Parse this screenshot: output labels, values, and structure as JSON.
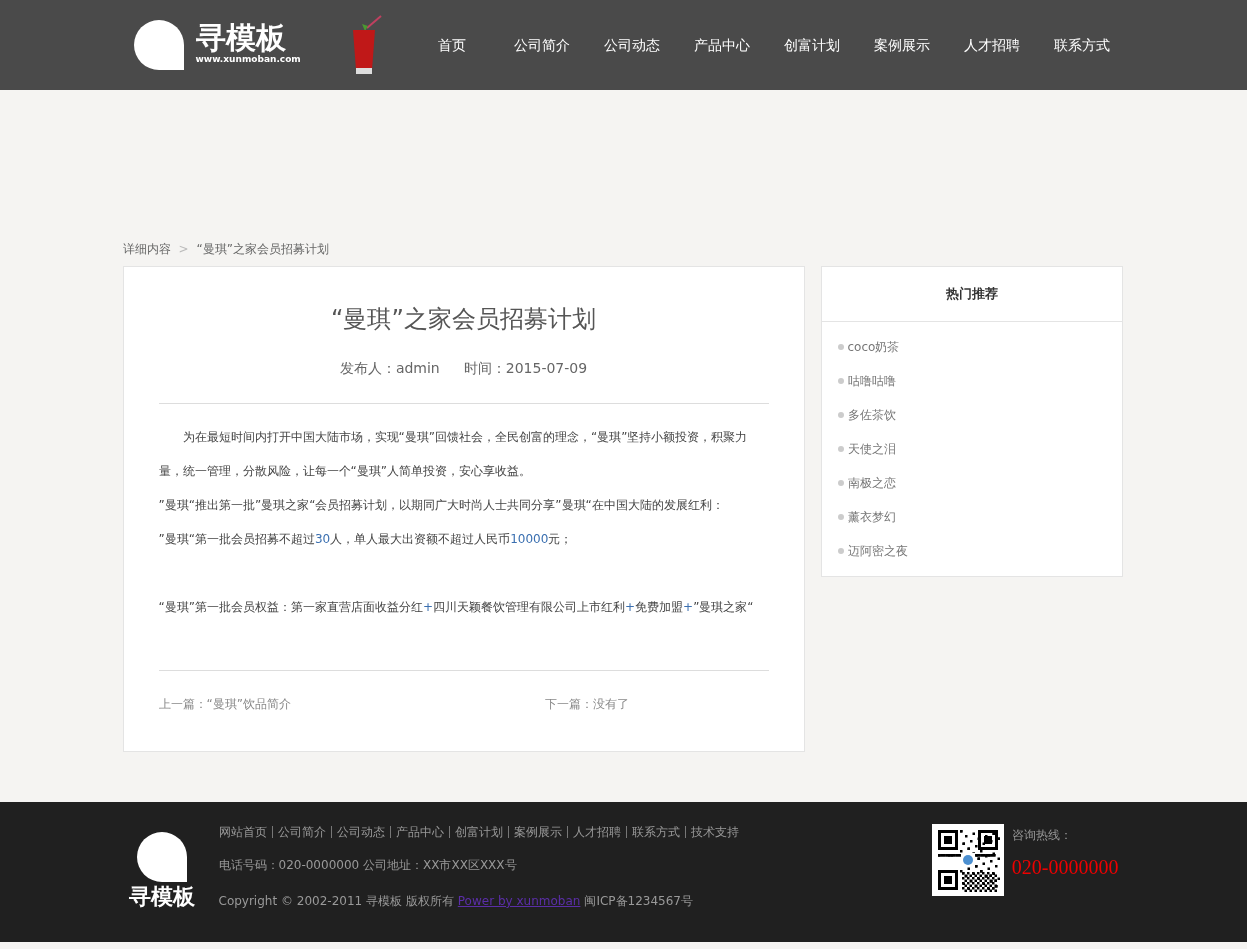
{
  "header": {
    "logo_text": "寻模板",
    "logo_url": "www.xunmoban.com",
    "nav": [
      {
        "label": "首页",
        "selected": false
      },
      {
        "label": "公司简介",
        "selected": false
      },
      {
        "label": "公司动态",
        "selected": false
      },
      {
        "label": "产品中心",
        "selected": false
      },
      {
        "label": "创富计划",
        "selected": false
      },
      {
        "label": "案例展示",
        "selected": false
      },
      {
        "label": "人才招聘",
        "selected": false
      },
      {
        "label": "联系方式",
        "selected": false
      }
    ]
  },
  "breadcrumb": [
    "详细内容",
    "“曼琪”之家会员招募计划"
  ],
  "breadcrumb_separator": ">",
  "article": {
    "title": "“曼琪”之家会员招募计划",
    "author": "发布人：admin",
    "date": "时间：2015-07-09",
    "paragraphs": [
      {
        "kind": "indent",
        "segments": [
          {
            "text": "为在最短时间内打开中国大陆市场，实现“曼琪”回馈社会，全民创富的理念，“曼琪”坚持小额投资，积聚力量，统一管理，分散风险，让每一个“曼琪”人简单投资，安心享收益。",
            "accent": false
          }
        ]
      },
      {
        "kind": "plain",
        "segments": [
          {
            "text": "”曼琪“推出第一批”曼琪之家“会员招募计划，以期同广大时尚人士共同分享”曼琪“在中国大陆的发展红利：",
            "accent": false
          }
        ]
      },
      {
        "kind": "plain",
        "segments": [
          {
            "text": "”曼琪“第一批会员招募不超过",
            "accent": false
          },
          {
            "text": "30",
            "accent": true
          },
          {
            "text": "人，单人最大出资额不超过人民币",
            "accent": false
          },
          {
            "text": "10000",
            "accent": true
          },
          {
            "text": "元；",
            "accent": false
          }
        ]
      },
      {
        "kind": "spaced",
        "segments": [
          {
            "text": "“曼琪”第一批会员权益：第一家直营店面收益分红",
            "accent": false
          },
          {
            "text": "+",
            "accent": true
          },
          {
            "text": "四川天颖餐饮管理有限公司上市红利",
            "accent": false
          },
          {
            "text": "+",
            "accent": true
          },
          {
            "text": "免费加盟",
            "accent": false
          },
          {
            "text": "+",
            "accent": true
          },
          {
            "text": "”曼琪之家“",
            "accent": false
          }
        ]
      }
    ],
    "prev": "上一篇：“曼琪”饮品简介",
    "next": "下一篇：没有了"
  },
  "sidebar": {
    "title": "热门推荐",
    "items": [
      "coco奶茶",
      "咕噜咕噜",
      "多佐茶饮",
      "天使之泪",
      "南极之恋",
      "薰衣梦幻",
      "迈阿密之夜"
    ]
  },
  "footer": {
    "logo_text": "寻模板",
    "links": [
      "网站首页",
      "公司简介",
      "公司动态",
      "产品中心",
      "创富计划",
      "案例展示",
      "人才招聘",
      "联系方式",
      "技术支持"
    ],
    "contact": "电话号码：020-0000000 公司地址：XX市XX区XXX号",
    "copyright": "Copyright © 2002-2011 寻模板 版权所有",
    "power_link": "Power by xunmoban",
    "icp": "闽ICP备1234567号",
    "hotline_label": "咨询热线：",
    "hotline": "020-0000000"
  }
}
